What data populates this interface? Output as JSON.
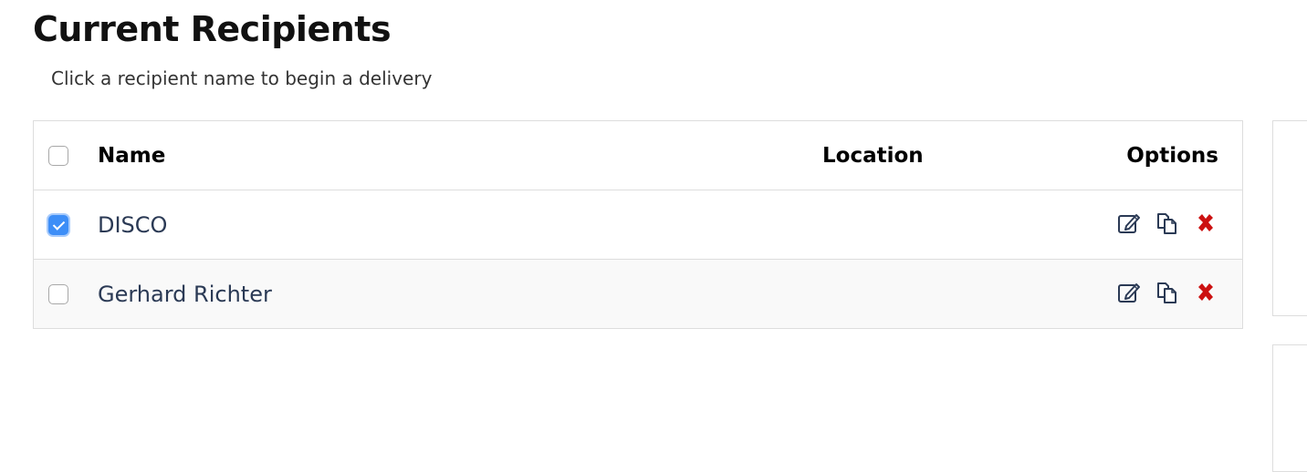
{
  "page": {
    "title": "Current Recipients",
    "subtitle": "Click a recipient name to begin a delivery"
  },
  "table": {
    "headers": {
      "name": "Name",
      "location": "Location",
      "options": "Options"
    },
    "rows": [
      {
        "name": "DISCO",
        "location": "",
        "checked": true
      },
      {
        "name": "Gerhard Richter",
        "location": "",
        "checked": false
      }
    ]
  },
  "icons": {
    "edit": "edit-icon",
    "copy": "copy-icon",
    "delete": "delete-icon"
  },
  "colors": {
    "link": "#2b3a55",
    "delete": "#cc1111",
    "checkbox_checked": "#3d8ef7",
    "border": "#dddddd",
    "row_stripe": "#f9f9f9"
  }
}
